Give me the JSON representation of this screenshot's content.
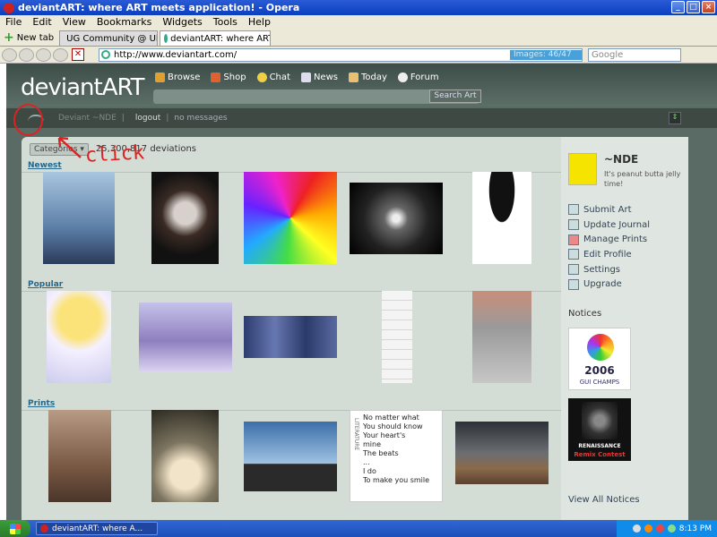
{
  "window": {
    "title": "deviantART: where ART meets application! - Opera"
  },
  "menu": [
    "File",
    "Edit",
    "View",
    "Bookmarks",
    "Widgets",
    "Tools",
    "Help"
  ],
  "tabs": {
    "new_tab": "New tab",
    "items": [
      {
        "label": "UG Community @ Ultima..."
      },
      {
        "label": "deviantART: where ART..."
      }
    ]
  },
  "address": {
    "url": "http://www.deviantart.com/",
    "images_badge": "Images: 46/47",
    "search_placeholder": "Google"
  },
  "site": {
    "logo": "deviantART",
    "nav": [
      {
        "label": "Browse",
        "icon": "book-icon"
      },
      {
        "label": "Shop",
        "icon": "cart-icon"
      },
      {
        "label": "Chat",
        "icon": "smiley-icon"
      },
      {
        "label": "News",
        "icon": "news-icon"
      },
      {
        "label": "Today",
        "icon": "person-icon"
      },
      {
        "label": "Forum",
        "icon": "speech-bubble-icon"
      }
    ],
    "search_button": "Search Art",
    "subbar": {
      "deviant": "Deviant ~NDE",
      "logout": "logout",
      "sep": "|",
      "messages": "no messages"
    },
    "categories_button": "Categories ▾",
    "deviation_count": "25,300,817 deviations",
    "sections": [
      {
        "label": "Newest"
      },
      {
        "label": "Popular"
      },
      {
        "label": "Prints"
      }
    ],
    "lit_text": {
      "tag": "LITERATURE",
      "lines": [
        "No matter what",
        "You should know",
        "Your heart's",
        "mine",
        "The beats",
        "...",
        "I do",
        "To make you smile"
      ]
    }
  },
  "sidebar": {
    "username": "~NDE",
    "tagline": "It's peanut butta jelly time!",
    "links": [
      {
        "label": "Submit Art"
      },
      {
        "label": "Update Journal"
      },
      {
        "label": "Manage Prints"
      },
      {
        "label": "Edit Profile"
      },
      {
        "label": "Settings"
      },
      {
        "label": "Upgrade"
      }
    ],
    "notices_heading": "Notices",
    "notice1": {
      "year": "2006",
      "caption": "GUI CHAMPS"
    },
    "notice2": {
      "title": "RENAISSANCE",
      "caption": "Remix Contest"
    },
    "view_all": "View All Notices"
  },
  "annotation": {
    "text": "click"
  },
  "taskbar": {
    "task": "deviantART: where A...",
    "time": "8:13 PM"
  }
}
